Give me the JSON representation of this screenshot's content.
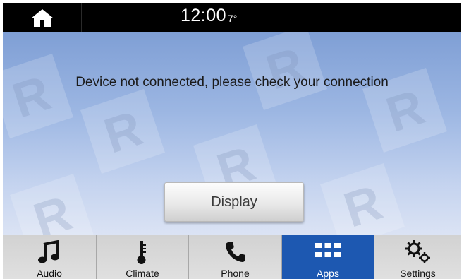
{
  "status_bar": {
    "home_icon": "home-icon",
    "clock": "12:00",
    "temperature": "7°"
  },
  "main": {
    "message": "Device not connected, please check your connection",
    "display_button_label": "Display"
  },
  "nav": {
    "active": "Apps",
    "items": [
      {
        "label": "Audio",
        "icon": "music-note-icon"
      },
      {
        "label": "Climate",
        "icon": "thermometer-icon"
      },
      {
        "label": "Phone",
        "icon": "phone-icon"
      },
      {
        "label": "Apps",
        "icon": "apps-grid-icon"
      },
      {
        "label": "Settings",
        "icon": "gears-icon"
      }
    ]
  },
  "colors": {
    "status_bar_bg": "#000000",
    "main_bg_top": "#7f9fd5",
    "main_bg_bottom": "#dbe3f4",
    "nav_bg": "#d9d9d9",
    "nav_active_bg": "#1d58b1",
    "text": "#1b1b1b"
  }
}
